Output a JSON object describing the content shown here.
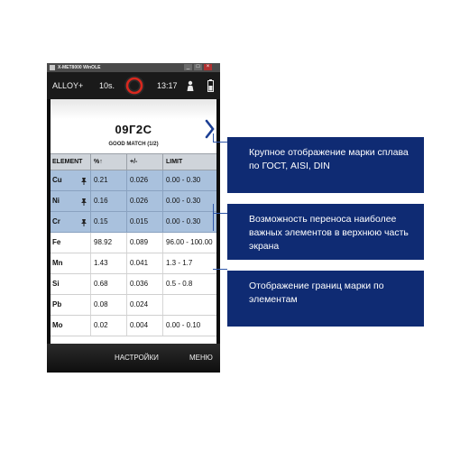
{
  "window": {
    "title": "X-MET8000 WinOLE",
    "controls": [
      "_",
      "□",
      "×"
    ]
  },
  "statusbar": {
    "mode": "ALLOY+",
    "time_setting": "10s.",
    "clock": "13:17",
    "icons": [
      "trigger-icon",
      "person-icon",
      "battery-icon"
    ]
  },
  "result": {
    "grade": "09Г2С",
    "match": "GOOD MATCH (1/2)"
  },
  "table": {
    "headers": [
      "ELEMENT",
      "%↑",
      "+/-",
      "LIMIT"
    ],
    "rows": [
      {
        "element": "Cu",
        "pinned": true,
        "pct": "0.21",
        "err": "0.026",
        "limit": "0.00 - 0.30"
      },
      {
        "element": "Ni",
        "pinned": true,
        "pct": "0.16",
        "err": "0.026",
        "limit": "0.00 - 0.30"
      },
      {
        "element": "Cr",
        "pinned": true,
        "pct": "0.15",
        "err": "0.015",
        "limit": "0.00 - 0.30"
      },
      {
        "element": "Fe",
        "pinned": false,
        "pct": "98.92",
        "err": "0.089",
        "limit": "96.00 - 100.00"
      },
      {
        "element": "Mn",
        "pinned": false,
        "pct": "1.43",
        "err": "0.041",
        "limit": "1.3 - 1.7"
      },
      {
        "element": "Si",
        "pinned": false,
        "pct": "0.68",
        "err": "0.036",
        "limit": "0.5 - 0.8"
      },
      {
        "element": "Pb",
        "pinned": false,
        "pct": "0.08",
        "err": "0.024",
        "limit": ""
      },
      {
        "element": "Mo",
        "pinned": false,
        "pct": "0.02",
        "err": "0.004",
        "limit": "0.00 - 0.10"
      }
    ]
  },
  "bottombar": {
    "settings_label": "НАСТРОЙКИ",
    "menu_label": "МЕНЮ"
  },
  "callouts": [
    {
      "text": "Крупное отображение марки сплава по ГОСТ, AISI, DIN"
    },
    {
      "text": "Возможность переноса наиболее важных элементов в верхнюю часть экрана"
    },
    {
      "text": "Отображение границ марки по элементам"
    }
  ],
  "colors": {
    "callout_bg": "#0f2b73",
    "pinned_row": "#a9c1dd",
    "header_row": "#cfd4da",
    "trigger_ring": "#d8281e"
  }
}
